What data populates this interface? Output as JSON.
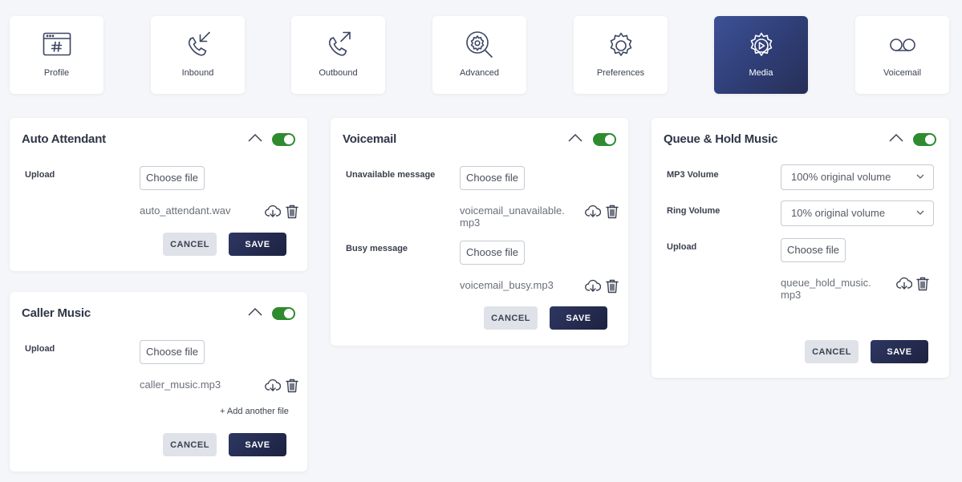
{
  "tabs": [
    {
      "label": "Profile",
      "icon": "profile-hash-icon",
      "active": false
    },
    {
      "label": "Inbound",
      "icon": "inbound-call-icon",
      "active": false
    },
    {
      "label": "Outbound",
      "icon": "outbound-call-icon",
      "active": false
    },
    {
      "label": "Advanced",
      "icon": "advanced-search-gear-icon",
      "active": false
    },
    {
      "label": "Preferences",
      "icon": "gear-icon",
      "active": false
    },
    {
      "label": "Media",
      "icon": "media-gear-play-icon",
      "active": true
    },
    {
      "label": "Voicemail",
      "icon": "voicemail-icon",
      "active": false
    }
  ],
  "auto_attendant": {
    "title": "Auto Attendant",
    "upload_label": "Upload",
    "choose_file": "Choose file",
    "file_name": "auto_attendant.wav",
    "cancel": "CANCEL",
    "save": "SAVE",
    "enabled": true
  },
  "caller_music": {
    "title": "Caller Music",
    "upload_label": "Upload",
    "choose_file": "Choose file",
    "file_name": "caller_music.mp3",
    "add_another": "+ Add another file",
    "cancel": "CANCEL",
    "save": "SAVE",
    "enabled": true
  },
  "voicemail": {
    "title": "Voicemail",
    "unavailable_label": "Unavailable message",
    "unavailable_choose": "Choose file",
    "unavailable_file_1": "voicemail_unavailable.",
    "unavailable_file_2": "mp3",
    "busy_label": "Busy message",
    "busy_choose": "Choose file",
    "busy_file": "voicemail_busy.mp3",
    "cancel": "CANCEL",
    "save": "SAVE",
    "enabled": true
  },
  "queue_hold": {
    "title": "Queue & Hold Music",
    "mp3_volume_label": "MP3 Volume",
    "mp3_volume_value": "100% original volume",
    "ring_volume_label": "Ring Volume",
    "ring_volume_value": "10% original volume",
    "upload_label": "Upload",
    "choose_file": "Choose file",
    "file_name_1": "queue_hold_music.",
    "file_name_2": "mp3",
    "cancel": "CANCEL",
    "save": "SAVE",
    "enabled": true
  },
  "colors": {
    "active_tab": "#2e3d74",
    "toggle_on": "#2e8b2e",
    "save_button": "#232a4e",
    "cancel_button": "#dfe2e8"
  }
}
